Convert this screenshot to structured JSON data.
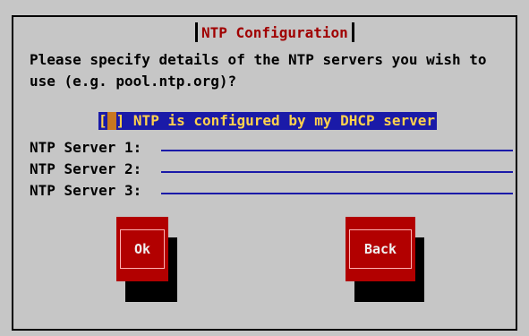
{
  "dialog": {
    "title": "NTP Configuration",
    "prompt": "Please specify details of the NTP servers you wish to\nuse (e.g. pool.ntp.org)?",
    "checkbox": {
      "open": "[",
      "mark": "*",
      "close": "]",
      "label": "NTP is configured by my DHCP server",
      "checked": true
    },
    "fields": [
      {
        "label": "NTP Server 1:",
        "value": ""
      },
      {
        "label": "NTP Server 2:",
        "value": ""
      },
      {
        "label": "NTP Server 3:",
        "value": ""
      }
    ],
    "buttons": {
      "ok": "Ok",
      "back": "Back"
    }
  },
  "colors": {
    "background": "#c6c6c6",
    "title": "#a00000",
    "selection": "#1a1aa8",
    "selection_text": "#ffd24d",
    "button": "#b20000"
  }
}
